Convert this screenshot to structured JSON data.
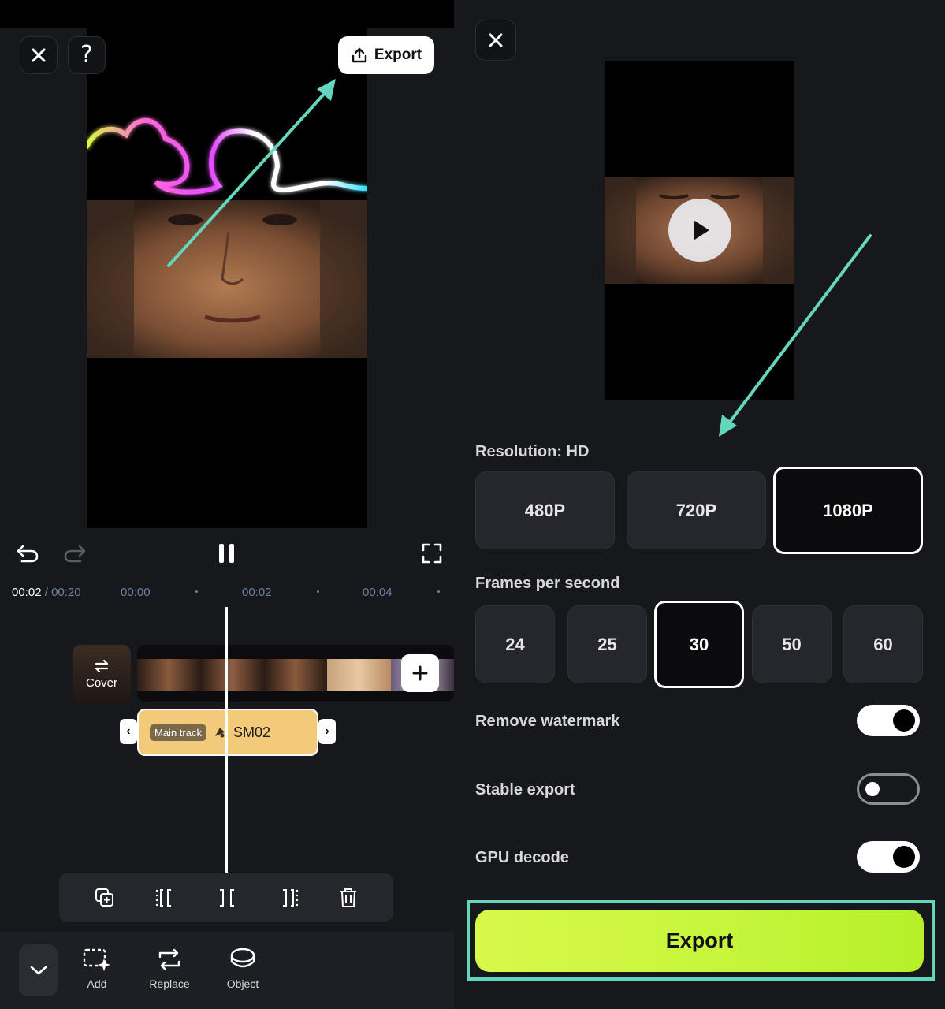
{
  "editor": {
    "export_label": "Export",
    "help_label": "?",
    "timecode_current": "00:02",
    "timecode_separator": " / ",
    "timecode_total": "00:20",
    "ruler_ticks": [
      "00:00",
      "00:02",
      "00:04"
    ],
    "cover_label": "Cover",
    "track_tag": "Main track",
    "track_name": "SM02",
    "nav": {
      "add": "Add",
      "replace": "Replace",
      "object": "Object"
    }
  },
  "export_panel": {
    "resolution_label": "Resolution: HD",
    "resolutions": [
      "480P",
      "720P",
      "1080P"
    ],
    "selected_resolution": "1080P",
    "fps_label": "Frames per second",
    "fps_options": [
      "24",
      "25",
      "30",
      "50",
      "60"
    ],
    "selected_fps": "30",
    "toggles": {
      "remove_watermark": {
        "label": "Remove watermark",
        "on": true
      },
      "stable_export": {
        "label": "Stable export",
        "on": false
      },
      "gpu_decode": {
        "label": "GPU decode",
        "on": true
      }
    },
    "export_button": "Export"
  },
  "colors": {
    "accent_teal": "#64d6bd",
    "export_green": "#c5f53a",
    "clip_yellow": "#f3c97a",
    "panel_bg": "#17181c"
  }
}
